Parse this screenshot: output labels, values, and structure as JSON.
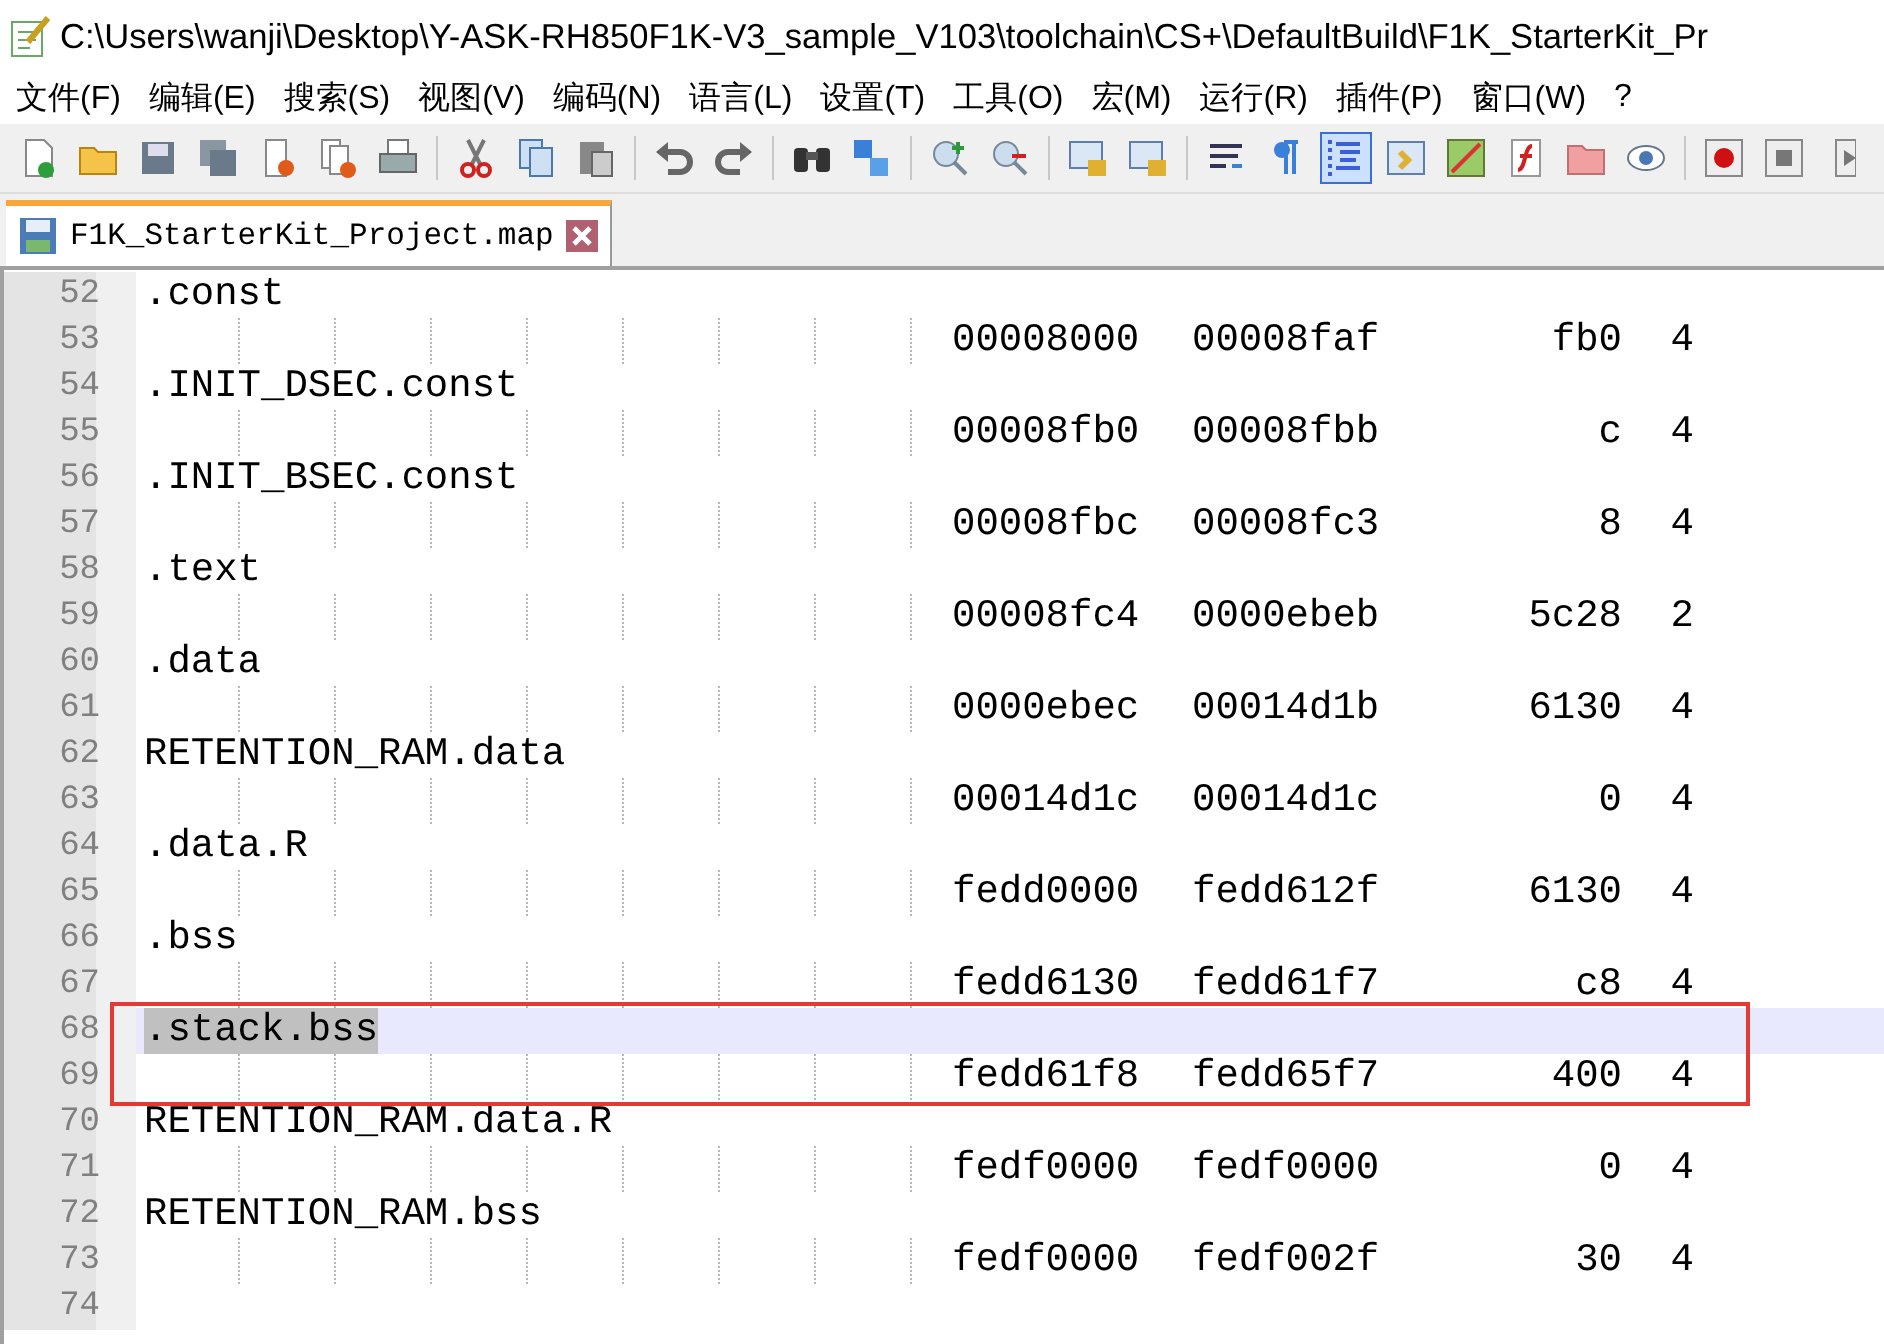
{
  "window": {
    "title": "C:\\Users\\wanji\\Desktop\\Y-ASK-RH850F1K-V3_sample_V103\\toolchain\\CS+\\DefaultBuild\\F1K_StarterKit_Pr"
  },
  "menu": [
    "文件(F)",
    "编辑(E)",
    "搜索(S)",
    "视图(V)",
    "编码(N)",
    "语言(L)",
    "设置(T)",
    "工具(O)",
    "宏(M)",
    "运行(R)",
    "插件(P)",
    "窗口(W)",
    "?"
  ],
  "toolbar": [
    {
      "kind": "new",
      "selected": false
    },
    {
      "kind": "open",
      "selected": false
    },
    {
      "kind": "save",
      "selected": false
    },
    {
      "kind": "save-all",
      "selected": false
    },
    {
      "kind": "close",
      "selected": false
    },
    {
      "kind": "close-all",
      "selected": false
    },
    {
      "kind": "print",
      "selected": false
    },
    {
      "kind": "sep"
    },
    {
      "kind": "cut",
      "selected": false
    },
    {
      "kind": "copy",
      "selected": false
    },
    {
      "kind": "paste",
      "selected": false
    },
    {
      "kind": "sep"
    },
    {
      "kind": "undo",
      "selected": false
    },
    {
      "kind": "redo",
      "selected": false
    },
    {
      "kind": "sep"
    },
    {
      "kind": "find",
      "selected": false
    },
    {
      "kind": "replace",
      "selected": false
    },
    {
      "kind": "sep"
    },
    {
      "kind": "zoom-in",
      "selected": false
    },
    {
      "kind": "zoom-out",
      "selected": false
    },
    {
      "kind": "sep"
    },
    {
      "kind": "lock",
      "selected": false
    },
    {
      "kind": "lock",
      "selected": false
    },
    {
      "kind": "sep"
    },
    {
      "kind": "wrap",
      "selected": false
    },
    {
      "kind": "pilcrow",
      "selected": false
    },
    {
      "kind": "indent",
      "selected": true
    },
    {
      "kind": "window",
      "selected": false
    },
    {
      "kind": "map",
      "selected": false
    },
    {
      "kind": "function",
      "selected": false
    },
    {
      "kind": "folder",
      "selected": false
    },
    {
      "kind": "eye",
      "selected": false
    },
    {
      "kind": "sep"
    },
    {
      "kind": "record",
      "selected": false
    },
    {
      "kind": "stop",
      "selected": false
    },
    {
      "kind": "play",
      "selected": false
    }
  ],
  "tabs": [
    {
      "label": "F1K_StarterKit_Project.map",
      "selected": true
    }
  ],
  "editor": {
    "lines": [
      {
        "number": "52",
        "kind": "section",
        "text": ".const",
        "current": false,
        "annotated": false,
        "selected_text": false
      },
      {
        "number": "53",
        "kind": "range",
        "start": "00008000",
        "end": "00008faf",
        "size": "fb0",
        "align": "4",
        "current": false,
        "annotated": false
      },
      {
        "number": "54",
        "kind": "section",
        "text": ".INIT_DSEC.const",
        "current": false,
        "annotated": false,
        "selected_text": false
      },
      {
        "number": "55",
        "kind": "range",
        "start": "00008fb0",
        "end": "00008fbb",
        "size": "c",
        "align": "4",
        "current": false,
        "annotated": false
      },
      {
        "number": "56",
        "kind": "section",
        "text": ".INIT_BSEC.const",
        "current": false,
        "annotated": false,
        "selected_text": false
      },
      {
        "number": "57",
        "kind": "range",
        "start": "00008fbc",
        "end": "00008fc3",
        "size": "8",
        "align": "4",
        "current": false,
        "annotated": false
      },
      {
        "number": "58",
        "kind": "section",
        "text": ".text",
        "current": false,
        "annotated": false,
        "selected_text": false
      },
      {
        "number": "59",
        "kind": "range",
        "start": "00008fc4",
        "end": "0000ebeb",
        "size": "5c28",
        "align": "2",
        "current": false,
        "annotated": false
      },
      {
        "number": "60",
        "kind": "section",
        "text": ".data",
        "current": false,
        "annotated": false,
        "selected_text": false
      },
      {
        "number": "61",
        "kind": "range",
        "start": "0000ebec",
        "end": "00014d1b",
        "size": "6130",
        "align": "4",
        "current": false,
        "annotated": false
      },
      {
        "number": "62",
        "kind": "section",
        "text": "RETENTION_RAM.data",
        "current": false,
        "annotated": false,
        "selected_text": false
      },
      {
        "number": "63",
        "kind": "range",
        "start": "00014d1c",
        "end": "00014d1c",
        "size": "0",
        "align": "4",
        "current": false,
        "annotated": false
      },
      {
        "number": "64",
        "kind": "section",
        "text": ".data.R",
        "current": false,
        "annotated": false,
        "selected_text": false
      },
      {
        "number": "65",
        "kind": "range",
        "start": "fedd0000",
        "end": "fedd612f",
        "size": "6130",
        "align": "4",
        "current": false,
        "annotated": false
      },
      {
        "number": "66",
        "kind": "section",
        "text": ".bss",
        "current": false,
        "annotated": false,
        "selected_text": false
      },
      {
        "number": "67",
        "kind": "range",
        "start": "fedd6130",
        "end": "fedd61f7",
        "size": "c8",
        "align": "4",
        "current": false,
        "annotated": false
      },
      {
        "number": "68",
        "kind": "section",
        "text": ".stack.bss",
        "current": true,
        "annotated": true,
        "selected_text": true
      },
      {
        "number": "69",
        "kind": "range",
        "start": "fedd61f8",
        "end": "fedd65f7",
        "size": "400",
        "align": "4",
        "current": false,
        "annotated": true
      },
      {
        "number": "70",
        "kind": "section",
        "text": "RETENTION_RAM.data.R",
        "current": false,
        "annotated": false,
        "selected_text": false
      },
      {
        "number": "71",
        "kind": "range",
        "start": "fedf0000",
        "end": "fedf0000",
        "size": "0",
        "align": "4",
        "current": false,
        "annotated": false
      },
      {
        "number": "72",
        "kind": "section",
        "text": "RETENTION_RAM.bss",
        "current": false,
        "annotated": false,
        "selected_text": false
      },
      {
        "number": "73",
        "kind": "range",
        "start": "fedf0000",
        "end": "fedf002f",
        "size": "30",
        "align": "4",
        "current": false,
        "annotated": false
      },
      {
        "number": "74",
        "kind": "empty",
        "current": false,
        "annotated": false
      }
    ]
  }
}
